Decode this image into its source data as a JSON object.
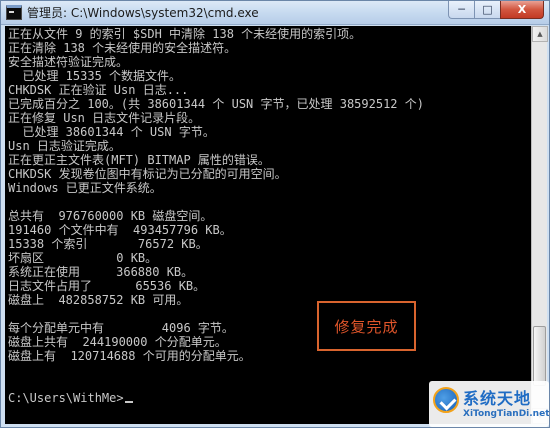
{
  "window": {
    "title": "管理员: C:\\Windows\\system32\\cmd.exe",
    "minimize_label": "─",
    "maximize_label": "□",
    "close_label": "X"
  },
  "console": {
    "lines": [
      "正在从文件 9 的索引 $SDH 中清除 138 个未经使用的索引项。",
      "正在清除 138 个未经使用的安全描述符。",
      "安全描述符验证完成。",
      "  已处理 15335 个数据文件。",
      "CHKDSK 正在验证 Usn 日志...",
      "已完成百分之 100。(共 38601344 个 USN 字节，已处理 38592512 个)",
      "正在修复 Usn 日志文件记录片段。",
      "  已处理 38601344 个 USN 字节。",
      "Usn 日志验证完成。",
      "正在更正主文件表(MFT) BITMAP 属性的错误。",
      "CHKDSK 发现卷位图中有标记为已分配的可用空间。",
      "Windows 已更正文件系统。",
      "",
      "总共有  976760000 KB 磁盘空间。",
      "191460 个文件中有  493457796 KB。",
      "15338 个索引       76572 KB。",
      "坏扇区          0 KB。",
      "系统正在使用     366880 KB。",
      "日志文件占用了      65536 KB。",
      "磁盘上  482858752 KB 可用。",
      "",
      "每个分配单元中有        4096 字节。",
      "磁盘上共有  244190000 个分配单元。",
      "磁盘上有  120714688 个可用的分配单元。"
    ],
    "prompt": "C:\\Users\\WithMe>"
  },
  "annotation": {
    "text": "修复完成",
    "color": "#e0552a"
  },
  "watermark": {
    "title": "系统天地",
    "url": "XiTongTianDi.net"
  },
  "colors": {
    "console_bg": "#000000",
    "console_fg": "#c8c8c8",
    "titlebar": "#c5d9ef",
    "close_button": "#c23a24"
  }
}
